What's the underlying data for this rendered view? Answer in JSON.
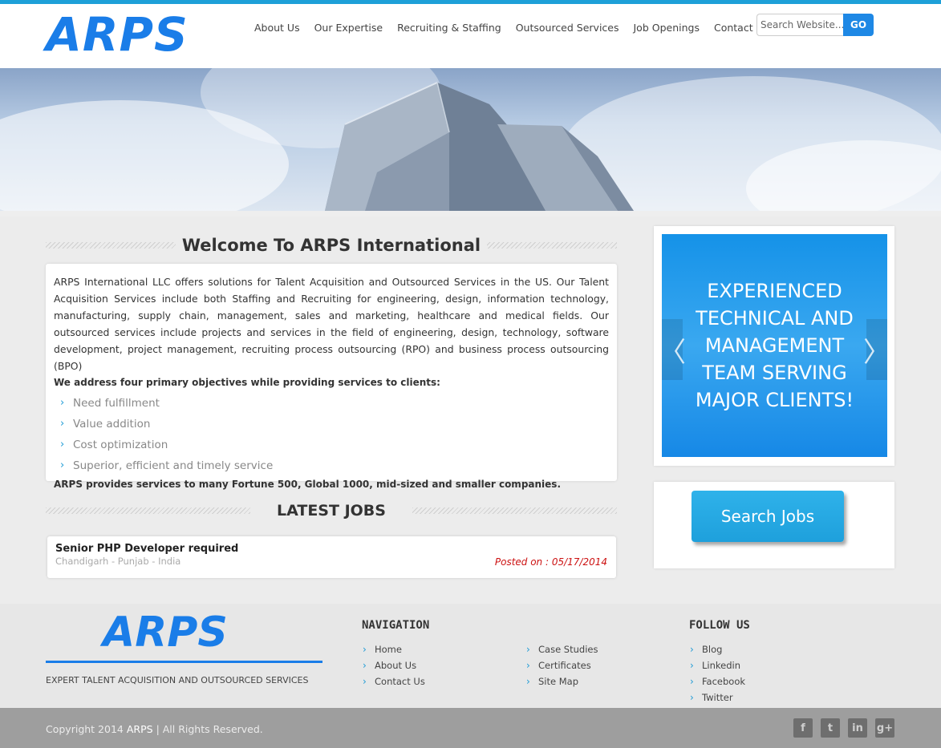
{
  "header": {
    "logo": "ARPS",
    "nav": [
      "About Us",
      "Our Expertise",
      "Recruiting & Staffing",
      "Outsourced Services",
      "Job Openings",
      "Contact Us"
    ],
    "search_placeholder": "Search Website...",
    "search_button": "GO"
  },
  "welcome": {
    "title": "Welcome To ARPS International",
    "paragraph": "ARPS International LLC offers solutions for Talent Acquisition and Outsourced Services in the US. Our Talent Acquisition Services include both Staffing and Recruiting for engineering, design, information technology, manufacturing, supply chain, management, sales and marketing, healthcare and medical fields. Our outsourced services include projects and services in the field of engineering, design, technology, software development, project management, recruiting process outsourcing (RPO) and business process outsourcing (BPO)",
    "objectives_intro": "We address four primary objectives while providing services to clients:",
    "objectives": [
      "Need fulfillment",
      "Value addition",
      "Cost optimization",
      "Superior, efficient and timely service"
    ],
    "closing": "ARPS provides services to many Fortune 500, Global 1000, mid-sized and smaller companies."
  },
  "jobs": {
    "title": "LATEST JOBS",
    "items": [
      {
        "title": "Senior PHP Developer required",
        "location": "Chandigarh - Punjab - India",
        "posted": "Posted on : 05/17/2014"
      }
    ]
  },
  "slider": {
    "slogan": "EXPERIENCED TECHNICAL AND MANAGEMENT TEAM SERVING MAJOR CLIENTS!",
    "prev_icon": "chevron-left-icon",
    "next_icon": "chevron-right-icon"
  },
  "search_jobs_button": "Search Jobs",
  "footer": {
    "logo": "ARPS",
    "tagline": "EXPERT TALENT ACQUISITION AND OUTSOURCED SERVICES",
    "navigation_heading": "NAVIGATION",
    "nav_col1": [
      "Home",
      "About Us",
      "Contact Us"
    ],
    "nav_col2": [
      "Case Studies",
      "Certificates",
      "Site Map"
    ],
    "follow_heading": "FOLLOW US",
    "follow": [
      "Blog",
      "Linkedin",
      "Facebook",
      "Twitter"
    ],
    "copyright_prefix": "Copyright 2014",
    "copyright_brand": "ARPS",
    "copyright_suffix": "| All Rights Reserved.",
    "social_icons": [
      "facebook-icon",
      "twitter-icon",
      "linkedin-icon",
      "google-plus-icon"
    ]
  },
  "colors": {
    "accent": "#1e88e5",
    "logo_blue": "#1a7de8",
    "link_blue": "#1e9bd6",
    "date_red": "#cc1111"
  }
}
